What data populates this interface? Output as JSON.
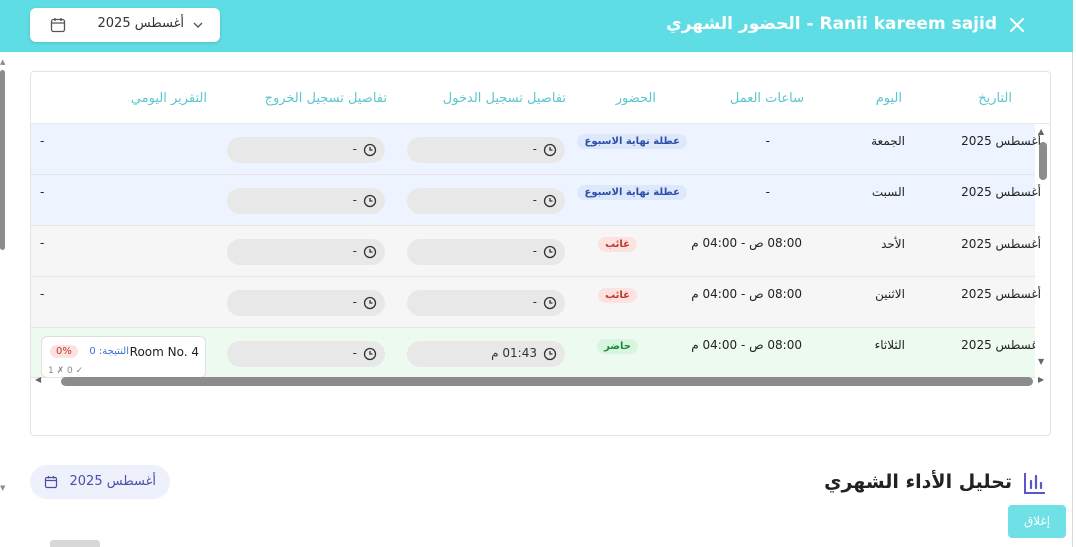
{
  "header": {
    "title": "Ranii kareem sajid - الحضور الشهري",
    "month_value": "أغسطس 2025"
  },
  "table": {
    "columns": [
      "التاريخ",
      "اليوم",
      "ساعات العمل",
      "الحضور",
      "تفاصيل تسجيل الدخول",
      "تفاصيل تسجيل الخروج",
      "التقرير اليومي"
    ],
    "rows": [
      {
        "date": "أغسطس 2025",
        "day": "الجمعة",
        "hours": "-",
        "status": "عطلة نهاية الاسبوع",
        "status_type": "weekend",
        "checkin": "-",
        "checkout": "-",
        "report": "-"
      },
      {
        "date": "أغسطس 2025",
        "day": "السبت",
        "hours": "-",
        "status": "عطلة نهاية الاسبوع",
        "status_type": "weekend",
        "checkin": "-",
        "checkout": "-",
        "report": "-"
      },
      {
        "date": "أغسطس 2025",
        "day": "الأحد",
        "hours": "08:00 ص - 04:00 م",
        "status": "غائب",
        "status_type": "absent",
        "checkin": "-",
        "checkout": "-",
        "report": "-"
      },
      {
        "date": "أغسطس 2025",
        "day": "الاثنين",
        "hours": "08:00 ص - 04:00 م",
        "status": "غائب",
        "status_type": "absent",
        "checkin": "-",
        "checkout": "-",
        "report": "-"
      },
      {
        "date": "أغسطس 2025",
        "day": "الثلاثاء",
        "hours": "08:00 ص - 04:00 م",
        "status": "حاضر",
        "status_type": "present",
        "checkin": "01:43 م",
        "checkout": "-",
        "report": ""
      }
    ],
    "room_card": {
      "name": "Room No. 4",
      "result": "النتيجة: 0",
      "percent": "0%",
      "sub": "1 ✗  0 ✓"
    }
  },
  "analysis": {
    "month_value": "أغسطس 2025",
    "title": "تحليل الأداء الشهري"
  },
  "footer": {
    "close_label": "إغلاق"
  },
  "colors": {
    "header": "#5fdde4",
    "accent_text": "#5bc6cf",
    "weekend_bg": "#eef4ff",
    "present_bg": "#edfaf0"
  }
}
